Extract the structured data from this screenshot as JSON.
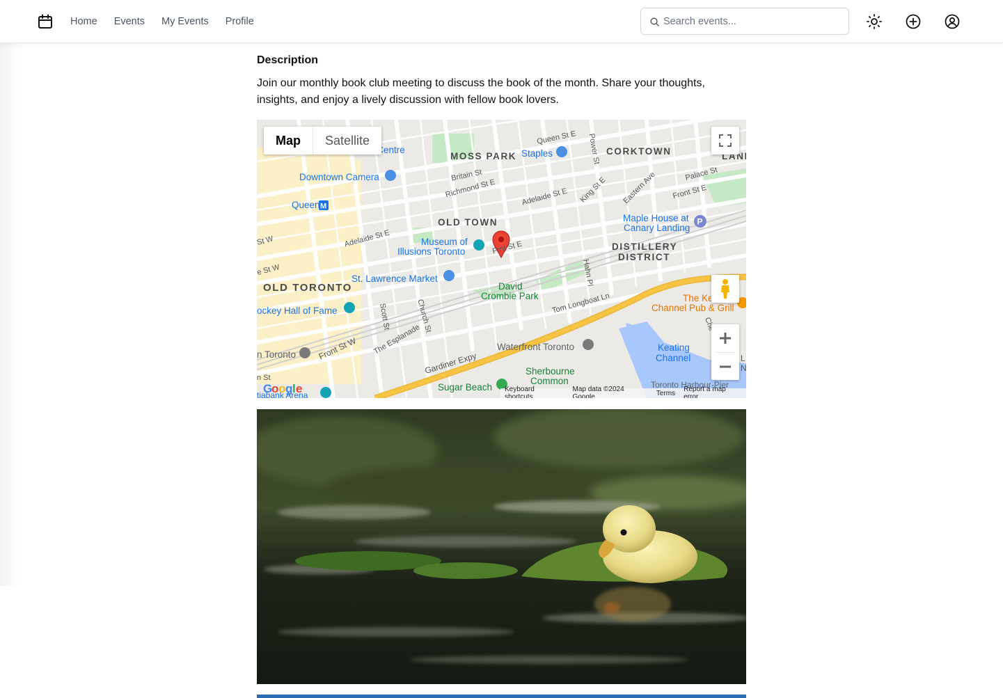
{
  "nav": {
    "items": [
      {
        "label": "Home"
      },
      {
        "label": "Events"
      },
      {
        "label": "My Events"
      },
      {
        "label": "Profile"
      }
    ]
  },
  "search": {
    "value": "",
    "placeholder": "Search events..."
  },
  "header_icons": [
    "calendar-icon",
    "sun-icon",
    "plus-circle-icon",
    "user-circle-icon"
  ],
  "description": {
    "title": "Description",
    "text": "Join our monthly book club meeting to discuss the book of the month. Share your thoughts, insights, and enjoy a lively discussion with fellow book lovers."
  },
  "map": {
    "type_controls": {
      "map": "Map",
      "satellite": "Satellite",
      "selected": "Map"
    },
    "districts": [
      "MOSS PARK",
      "CORKTOWN",
      "OLD TOWN",
      "DISTILLERY",
      "DISTRICT",
      "OLD TORONTO",
      "LAND"
    ],
    "pois": [
      "n Centre",
      "Staples",
      "Downtown Camera",
      "Queen",
      "Maple House at",
      "Canary Landing",
      "Museum of",
      "Illusions Toronto",
      "St. Lawrence Market",
      "David",
      "Crombie Park",
      "The Ke",
      "Channel Pub & Grill",
      "ockey Hall of Fame",
      "Waterfront Toronto",
      "Keating",
      "Channel",
      "n Toronto",
      "Sherbourne",
      "Common",
      "Sugar Beach",
      "Toronto Harbour-Pier",
      "tiabank Arena"
    ],
    "streets": [
      "Queen St E",
      "Power St",
      "Britain St",
      "Richmond St E",
      "Adelaide St E",
      "King St E",
      "Eastern Ave",
      "Palace St",
      "Front St E",
      "St W",
      "Adelaide St E",
      "Frnt St E",
      "e St W",
      "Hahn Pl",
      "Tom Longboat Ln",
      "Scott St",
      "Church St",
      "The Esplanade",
      "Front St W",
      "Gardiner Expy",
      "Che",
      "n St",
      "L",
      "N"
    ],
    "logo": "Google",
    "footer": [
      "Keyboard shortcuts",
      "Map data ©2024 Google",
      "Terms",
      "Report a map error"
    ],
    "zoom_in": "+",
    "zoom_out": "−"
  },
  "photo": {
    "subject": "duckling-on-lily-pads"
  },
  "colors": {
    "link_blue": "#1a73e8",
    "marker_red": "#ea4335",
    "highway_yellow": "#f6c342",
    "water_blue": "#a8c7fa",
    "park_green": "#c5e8c5"
  }
}
